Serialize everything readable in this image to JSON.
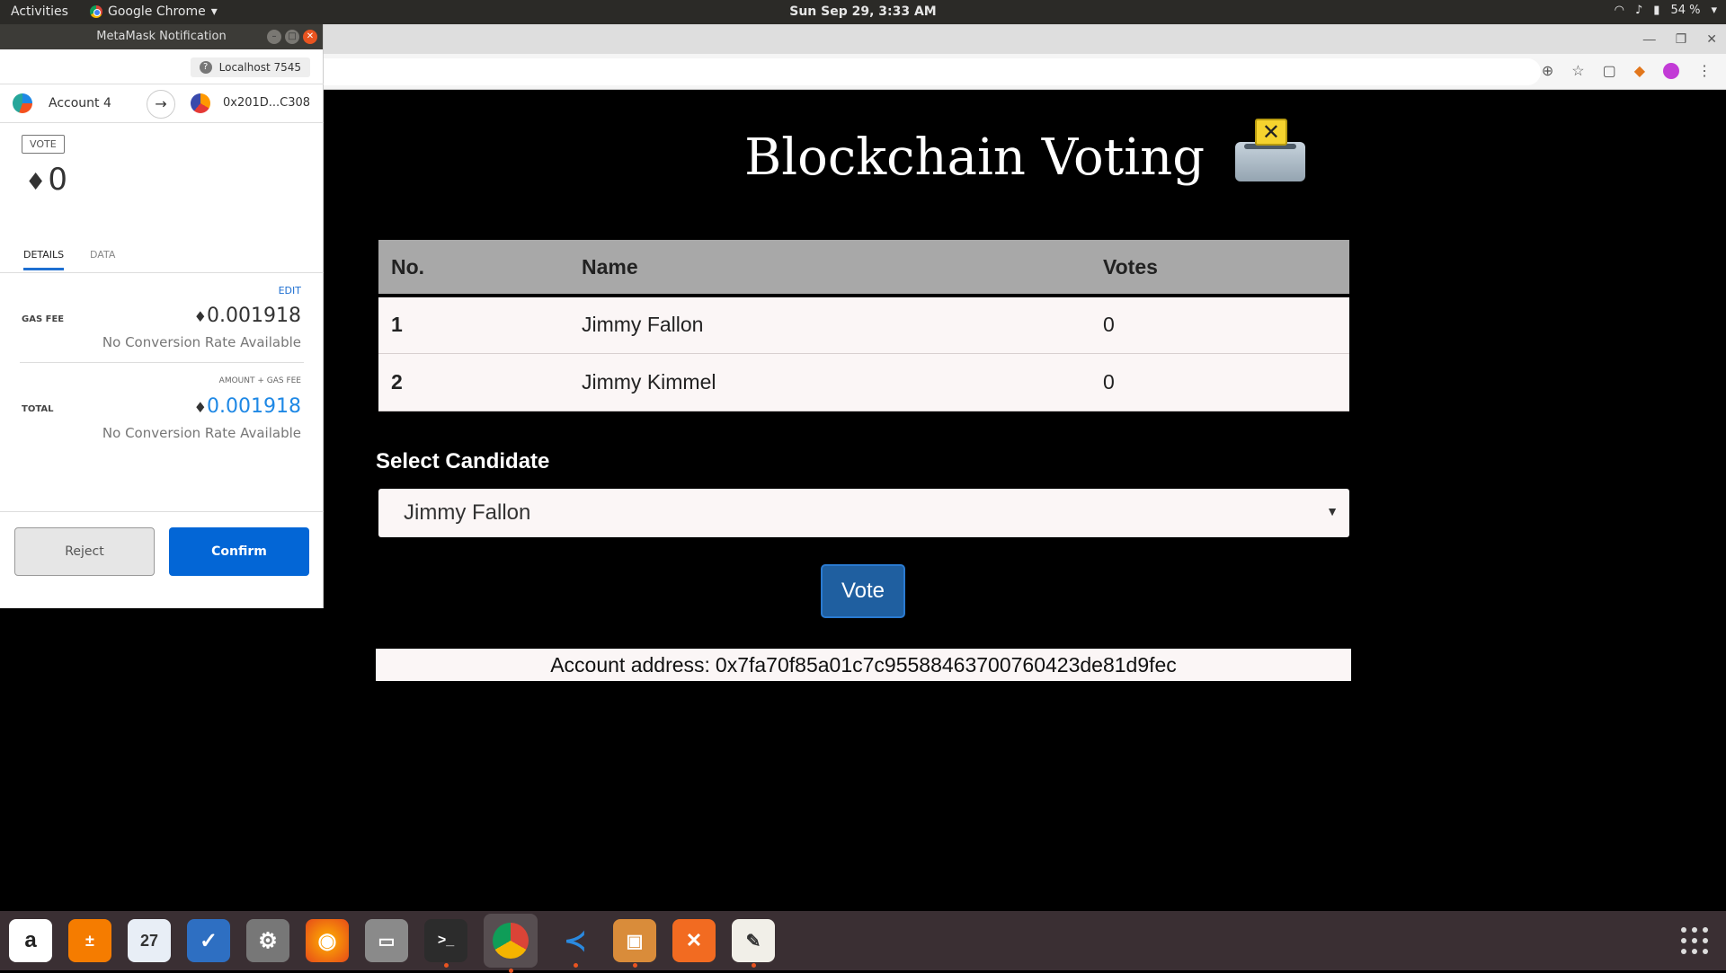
{
  "topbar": {
    "activities": "Activities",
    "app_name": "Google Chrome",
    "clock": "Sun Sep 29,  3:33 AM",
    "battery": "54 %"
  },
  "metamask": {
    "window_title": "MetaMask Notification",
    "network": "Localhost 7545",
    "from_account": "Account 4",
    "to_address": "0x201D...C308",
    "method": "VOTE",
    "amount": "0",
    "tabs": [
      "DETAILS",
      "DATA"
    ],
    "edit_label": "EDIT",
    "gas_fee_label": "GAS FEE",
    "gas_fee_value": "0.001918",
    "no_conversion": "No Conversion Rate Available",
    "amount_gas_label": "AMOUNT + GAS FEE",
    "total_label": "TOTAL",
    "total_value": "0.001918",
    "reject_label": "Reject",
    "confirm_label": "Confirm"
  },
  "page": {
    "title": "Blockchain Voting",
    "table": {
      "headers": [
        "No.",
        "Name",
        "Votes"
      ],
      "rows": [
        {
          "no": "1",
          "name": "Jimmy Fallon",
          "votes": "0"
        },
        {
          "no": "2",
          "name": "Jimmy Kimmel",
          "votes": "0"
        }
      ]
    },
    "select_label": "Select Candidate",
    "selected_candidate": "Jimmy Fallon",
    "vote_label": "Vote",
    "account_label": "Account address:",
    "account_address": "0x7fa70f85a01c7c95588463700760423de81d9fec"
  },
  "dock": {
    "calendar_day": "27"
  }
}
